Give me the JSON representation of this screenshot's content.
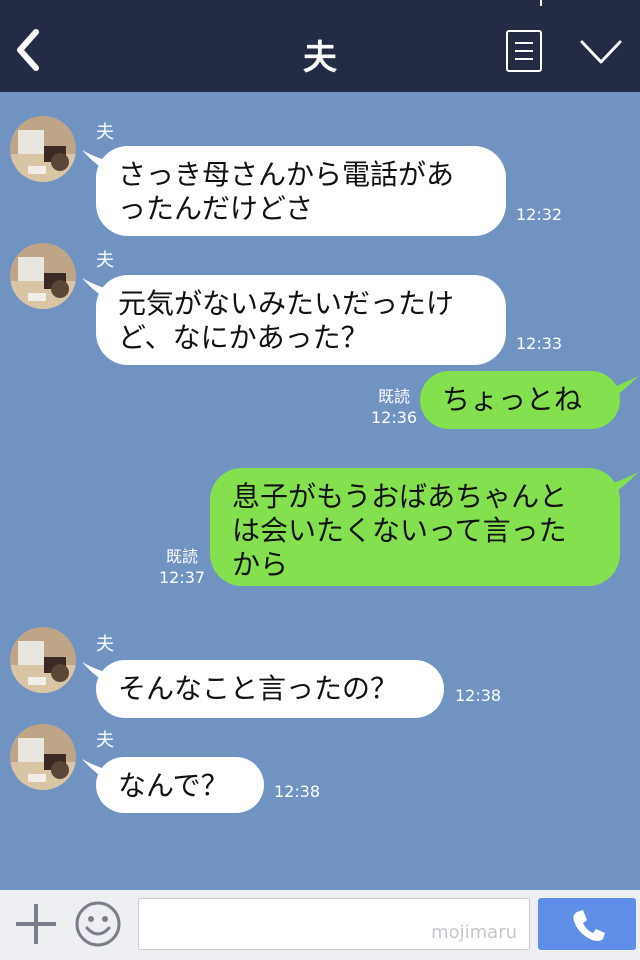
{
  "header": {
    "title": "夫"
  },
  "messages": [
    {
      "sender": "夫",
      "text": "さっき母さんから電話があ\nったんだけどさ",
      "time": "12:32"
    },
    {
      "sender": "夫",
      "text": "元気がないみたいだったけ\nど、なにかあった？",
      "time": "12:33"
    },
    {
      "text": "ちょっとね",
      "read": "既読",
      "time": "12:36"
    },
    {
      "text": "息子がもうおばあちゃんと\nは会いたくないって言った\nから",
      "read": "既読",
      "time": "12:37"
    },
    {
      "sender": "夫",
      "text": "そんなこと言ったの？",
      "time": "12:38"
    },
    {
      "sender": "夫",
      "text": "なんで？",
      "time": "12:38"
    }
  ],
  "input": {
    "watermark": "mojimaru"
  },
  "icons": {
    "back": "back-chevron-icon",
    "menu": "menu-icon",
    "collapse": "chevron-down-icon",
    "add": "plus-icon",
    "emoji": "smiley-icon",
    "call": "phone-icon"
  },
  "colors": {
    "header": "#232c44",
    "chat_background": "#7193c2",
    "incoming_bubble": "#ffffff",
    "outgoing_bubble": "#84e04e",
    "call_button": "#5f8ee6"
  }
}
